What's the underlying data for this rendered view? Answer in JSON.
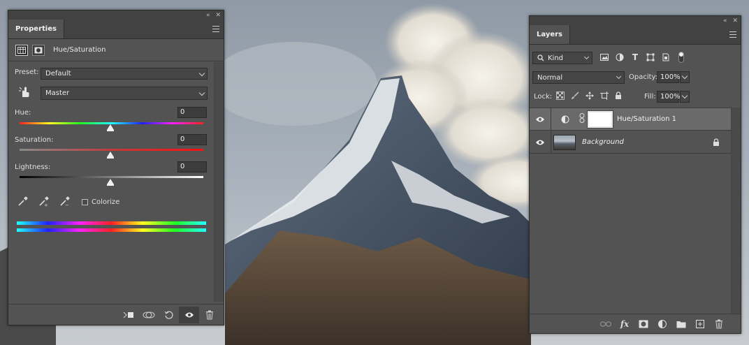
{
  "properties": {
    "tab_label": "Properties",
    "adjustment_title": "Hue/Saturation",
    "preset_label": "Preset:",
    "preset_value": "Default",
    "channel_value": "Master",
    "hue_label": "Hue:",
    "hue_value": "0",
    "saturation_label": "Saturation:",
    "saturation_value": "0",
    "lightness_label": "Lightness:",
    "lightness_value": "0",
    "colorize_label": "Colorize",
    "colorize_checked": false,
    "footer_icons": [
      "clip-to-layer-icon",
      "view-previous-icon",
      "reset-icon",
      "visibility-eye-icon",
      "trash-icon"
    ]
  },
  "layers": {
    "tab_label": "Layers",
    "kind_label": "Kind",
    "blend_mode": "Normal",
    "opacity_label": "Opacity:",
    "opacity_value": "100%",
    "lock_label": "Lock:",
    "fill_label": "Fill:",
    "fill_value": "100%",
    "items": [
      {
        "name": "Hue/Saturation 1",
        "visible": true,
        "selected": true,
        "type": "adjustment"
      },
      {
        "name": "Background",
        "visible": true,
        "selected": false,
        "locked": true,
        "italic": true,
        "type": "image"
      }
    ],
    "footer_icons": [
      "link-layers-icon",
      "fx-icon",
      "add-mask-icon",
      "adjustment-layer-icon",
      "new-group-icon",
      "new-layer-icon",
      "trash-icon"
    ]
  },
  "colors": {
    "panel_bg": "#535353",
    "panel_dark": "#424242",
    "selected_layer": "#6a6a6a",
    "text": "#dcdcdc"
  }
}
